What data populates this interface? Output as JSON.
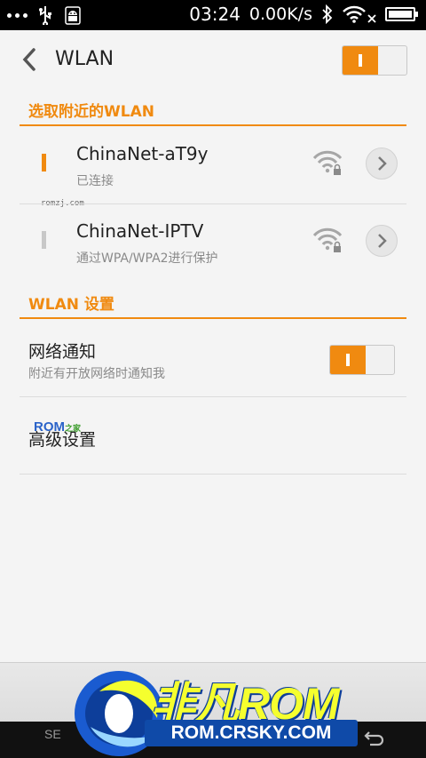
{
  "status_bar": {
    "time": "03:24",
    "speed": "0.00K/s",
    "icons": [
      "more-dots-icon",
      "usb-icon",
      "android-debug-icon",
      "bluetooth-icon",
      "wifi-icon",
      "close-icon",
      "battery-icon"
    ]
  },
  "header": {
    "title": "WLAN",
    "back_icon": "chevron-left-icon",
    "wlan_toggle_on": true
  },
  "nearby": {
    "section_title": "选取附近的WLAN",
    "networks": [
      {
        "name": "ChinaNet-aT9y",
        "status": "已连接",
        "active": true,
        "icons": [
          "wifi-lock-icon",
          "chevron-right-icon"
        ]
      },
      {
        "name": "ChinaNet-IPTV",
        "status": "通过WPA/WPA2进行保护",
        "active": false,
        "icons": [
          "wifi-lock-icon",
          "chevron-right-icon"
        ]
      }
    ],
    "watermark": "romzj.com"
  },
  "settings": {
    "section_title": "WLAN 设置",
    "notify": {
      "title": "网络通知",
      "subtitle": "附近有开放网络时通知我",
      "toggle_on": true
    },
    "advanced": {
      "title": "高级设置"
    },
    "overlay_mark": {
      "text": "ROM",
      "small": "之家"
    }
  },
  "branding": {
    "logo_text": "非凡ROM",
    "logo_url": "ROM.CRSKY.COM",
    "nav_left": "SE"
  },
  "colors": {
    "accent": "#f08a10",
    "background": "#f4f4f4",
    "text_primary": "#222222",
    "text_secondary": "#8a8a8a"
  }
}
